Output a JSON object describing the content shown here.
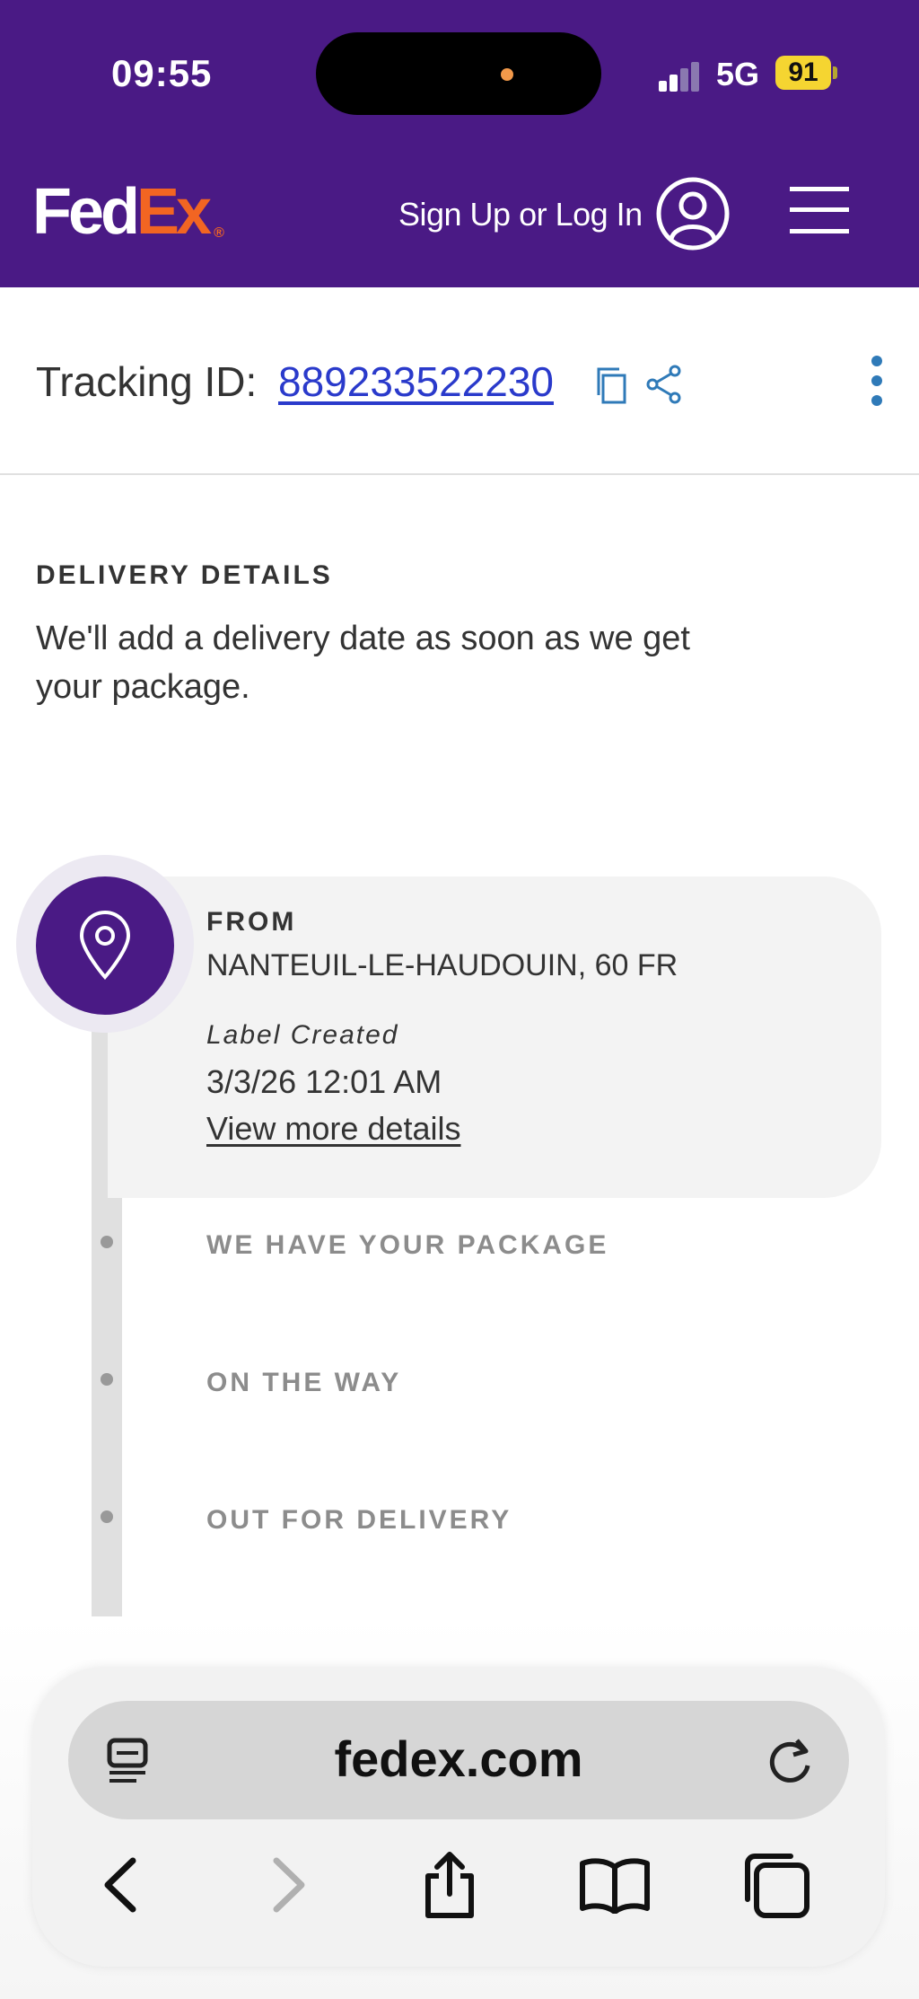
{
  "status_bar": {
    "time": "09:55",
    "network": "5G",
    "battery": "91"
  },
  "header": {
    "logo_fed": "Fed",
    "logo_ex": "Ex",
    "logo_reg": "®",
    "signin_label": "Sign Up or Log In",
    "icons": [
      "user-icon",
      "menu-icon"
    ]
  },
  "tracking": {
    "label": "Tracking ID:",
    "number": "889233522230",
    "icons": [
      "copy-icon",
      "share-icon",
      "more-icon"
    ]
  },
  "delivery": {
    "title": "DELIVERY DETAILS",
    "text": "We'll add a delivery date as soon as we get your package."
  },
  "timeline": {
    "from_label": "FROM",
    "from_place": "NANTEUIL-LE-HAUDOUIN, 60 FR",
    "status": "Label Created",
    "time": "3/3/26 12:01 AM",
    "link": "View more details",
    "steps": [
      "WE HAVE YOUR PACKAGE",
      "ON THE WAY",
      "OUT FOR DELIVERY"
    ]
  },
  "browser": {
    "url": "fedex.com",
    "toolbar": [
      "back-icon",
      "forward-icon",
      "share-icon",
      "bookmarks-icon",
      "tabs-icon"
    ]
  },
  "colors": {
    "brand_purple": "#4a1a85",
    "brand_orange": "#f26522",
    "link_blue": "#2a3acb",
    "icon_blue": "#2f7ab8"
  }
}
